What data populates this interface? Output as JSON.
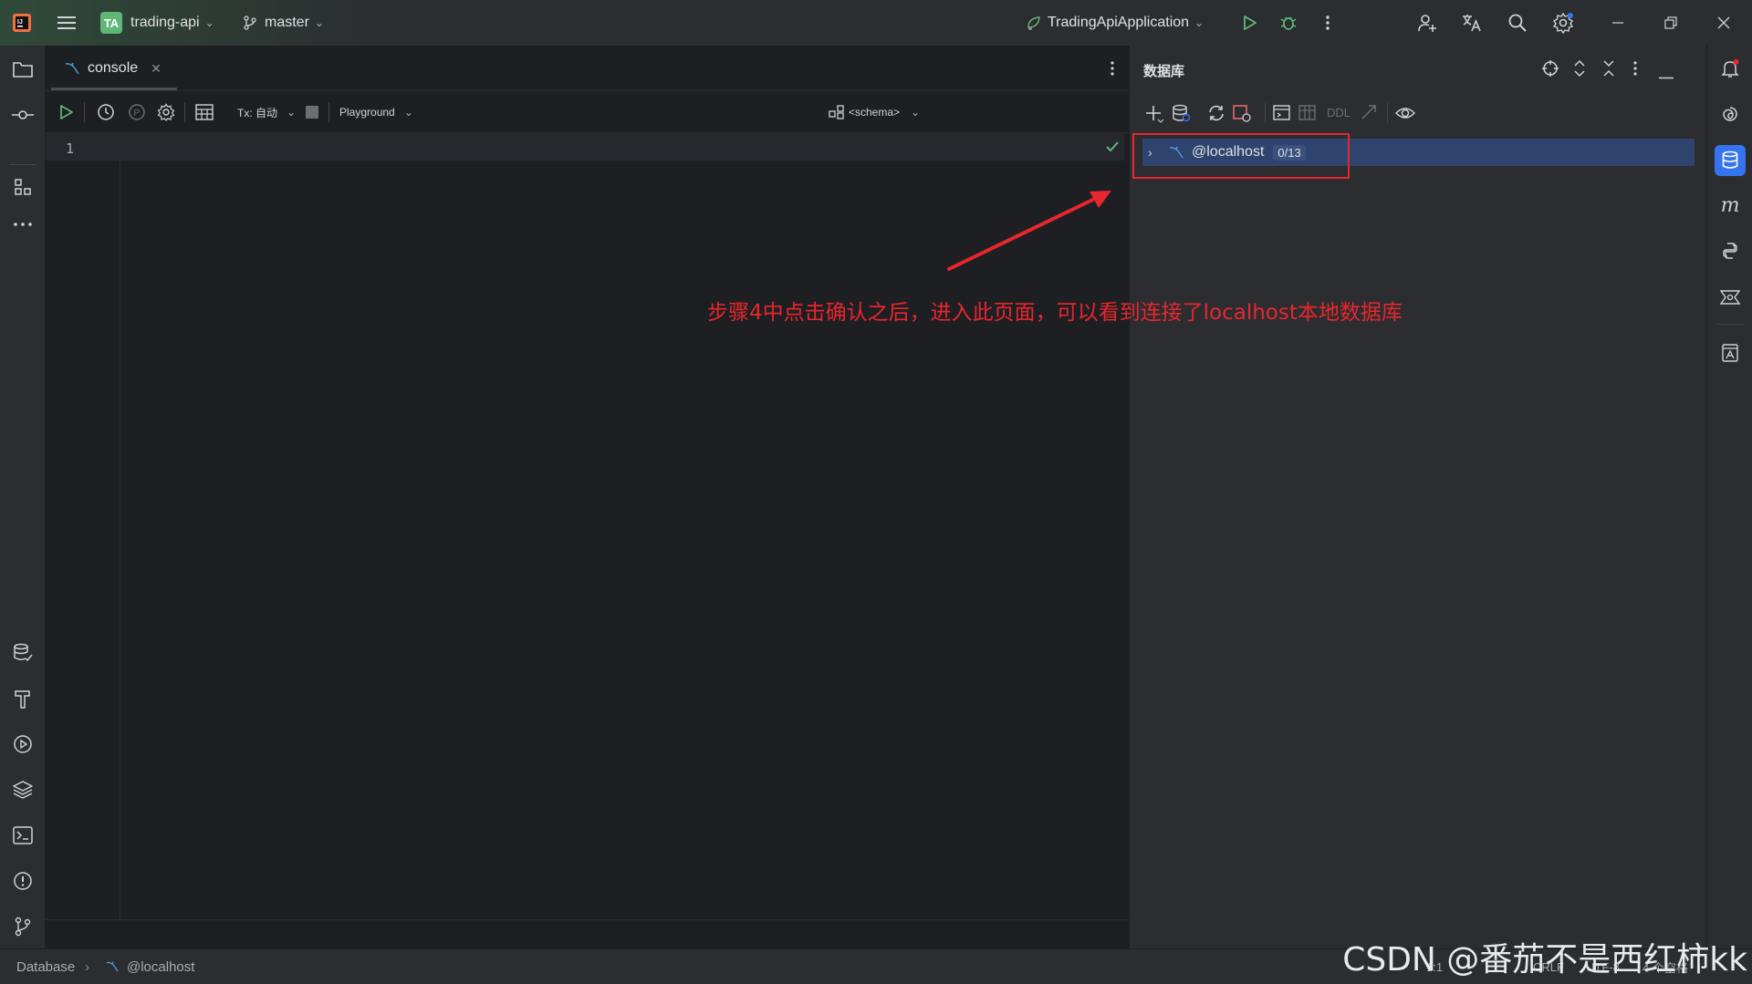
{
  "titlebar": {
    "project_badge": "TA",
    "project_name": "trading-api",
    "branch": "master",
    "run_config": "TradingApiApplication"
  },
  "editor": {
    "tab_label": "console",
    "tx_mode": "Tx: 自动",
    "playground": "Playground",
    "schema": "<schema>",
    "line_number": "1"
  },
  "db_panel": {
    "title": "数据库",
    "ddl_label": "DDL",
    "node_label": "@localhost",
    "node_counter": "0/13"
  },
  "annotation": {
    "text": "步骤4中点击确认之后，进入此页面，可以看到连接了localhost本地数据库",
    "color": "#e8262d"
  },
  "statusbar": {
    "crumb_root": "Database",
    "crumb_leaf": "@localhost",
    "position": "1:1",
    "line_ending": "CRLF",
    "encoding": "UTF-8",
    "indent": "4 个空格"
  },
  "watermark": "CSDN @番茄不是西红柿kk",
  "colors": {
    "accent": "#3574f0",
    "selection": "#2e436e",
    "run_green": "#5fb878"
  }
}
